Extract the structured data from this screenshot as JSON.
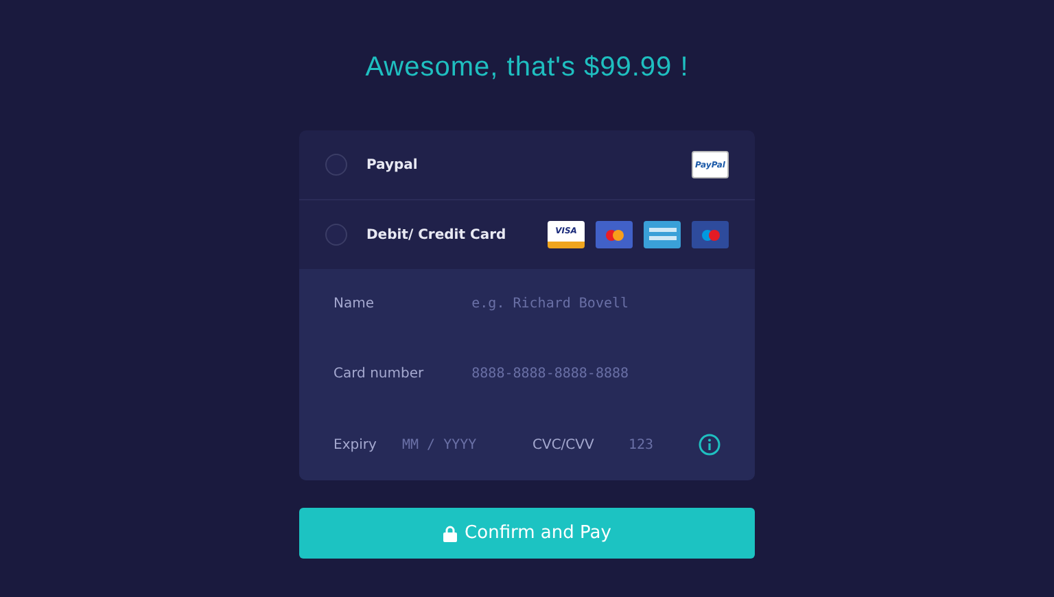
{
  "title": "Awesome, that's $99.99 !",
  "methods": [
    {
      "label": "Paypal",
      "selected": false,
      "logos": [
        {
          "kind": "paypal",
          "text": "PayPal"
        }
      ]
    },
    {
      "label": "Debit/ Credit Card",
      "selected": false,
      "logos": [
        {
          "kind": "visa",
          "text": "VISA"
        },
        {
          "kind": "mastercard"
        },
        {
          "kind": "amex"
        },
        {
          "kind": "maestro"
        }
      ]
    }
  ],
  "fields": {
    "name": {
      "label": "Name",
      "placeholder": "e.g. Richard Bovell"
    },
    "number": {
      "label": "Card number",
      "placeholder": "8888-8888-8888-8888"
    },
    "expiry": {
      "label": "Expiry",
      "placeholder": "MM / YYYY"
    },
    "cvc": {
      "label": "CVC/CVV",
      "placeholder": "123"
    }
  },
  "button": {
    "label": "Confirm and Pay"
  }
}
